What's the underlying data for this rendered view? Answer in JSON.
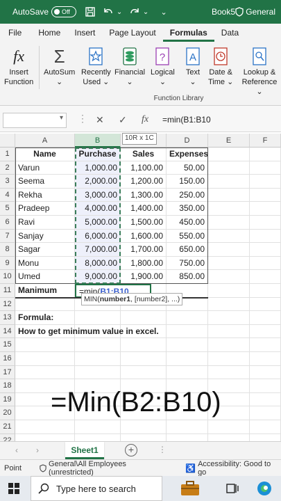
{
  "titlebar": {
    "autosave_label": "AutoSave",
    "autosave_state": "Off",
    "book_name": "Book5",
    "sensitivity": "General"
  },
  "ribbon_tabs": [
    "File",
    "Home",
    "Insert",
    "Page Layout",
    "Formulas",
    "Data"
  ],
  "active_tab": "Formulas",
  "ribbon_buttons": {
    "insert_function": [
      "Insert",
      "Function"
    ],
    "autosum": [
      "AutoSum",
      "⌄"
    ],
    "recently_used": [
      "Recently",
      "Used ⌄"
    ],
    "financial": [
      "Financial",
      "⌄"
    ],
    "logical": [
      "Logical",
      "⌄"
    ],
    "text": [
      "Text",
      "⌄"
    ],
    "date_time": [
      "Date &",
      "Time ⌄"
    ],
    "lookup": [
      "Lookup &",
      "Reference ⌄"
    ]
  },
  "ribbon_group_label": "Function Library",
  "formula_bar": {
    "name_box": "",
    "formula": "=min(B1:B10",
    "size_tooltip": "10R x 1C"
  },
  "columns": [
    "A",
    "B",
    "C",
    "D",
    "E",
    "F"
  ],
  "rows": [
    "1",
    "2",
    "3",
    "4",
    "5",
    "6",
    "7",
    "8",
    "9",
    "10",
    "11",
    "12",
    "13",
    "14",
    "15",
    "16",
    "17",
    "18",
    "19",
    "20",
    "21",
    "22"
  ],
  "table": {
    "headers": [
      "Name",
      "Purchase",
      "Sales",
      "Expenses"
    ],
    "data": [
      [
        "Varun",
        "1,000.00",
        "1,100.00",
        "50.00"
      ],
      [
        "Seema",
        "2,000.00",
        "1,200.00",
        "150.00"
      ],
      [
        "Rekha",
        "3,000.00",
        "1,300.00",
        "250.00"
      ],
      [
        "Pradeep",
        "4,000.00",
        "1,400.00",
        "350.00"
      ],
      [
        "Ravi",
        "5,000.00",
        "1,500.00",
        "450.00"
      ],
      [
        "Sanjay",
        "6,000.00",
        "1,600.00",
        "550.00"
      ],
      [
        "Sagar",
        "7,000.00",
        "1,700.00",
        "650.00"
      ],
      [
        "Monu",
        "8,000.00",
        "1,800.00",
        "750.00"
      ],
      [
        "Umed",
        "9,000.00",
        "1,900.00",
        "850.00"
      ]
    ]
  },
  "row11": {
    "label": "Manimum",
    "formula_prefix": "=min(",
    "formula_ref": "B1:B10"
  },
  "function_hint": {
    "fn": "MIN(",
    "arg1": "number1",
    "rest": ", [number2], ...)"
  },
  "notes": {
    "formula_label": "Formula:",
    "description": "How to get minimum value in excel."
  },
  "overlay_text": "=Min(B2:B10)",
  "sheet_tab": "Sheet1",
  "status": {
    "mode": "Point",
    "sensitivity": "General\\All Employees (unrestricted)",
    "accessibility": "Accessibility: Good to go"
  },
  "taskbar": {
    "search_placeholder": "Type here to search"
  },
  "colors": {
    "excel_green": "#217346",
    "ref_blue": "#3a5fcd"
  }
}
